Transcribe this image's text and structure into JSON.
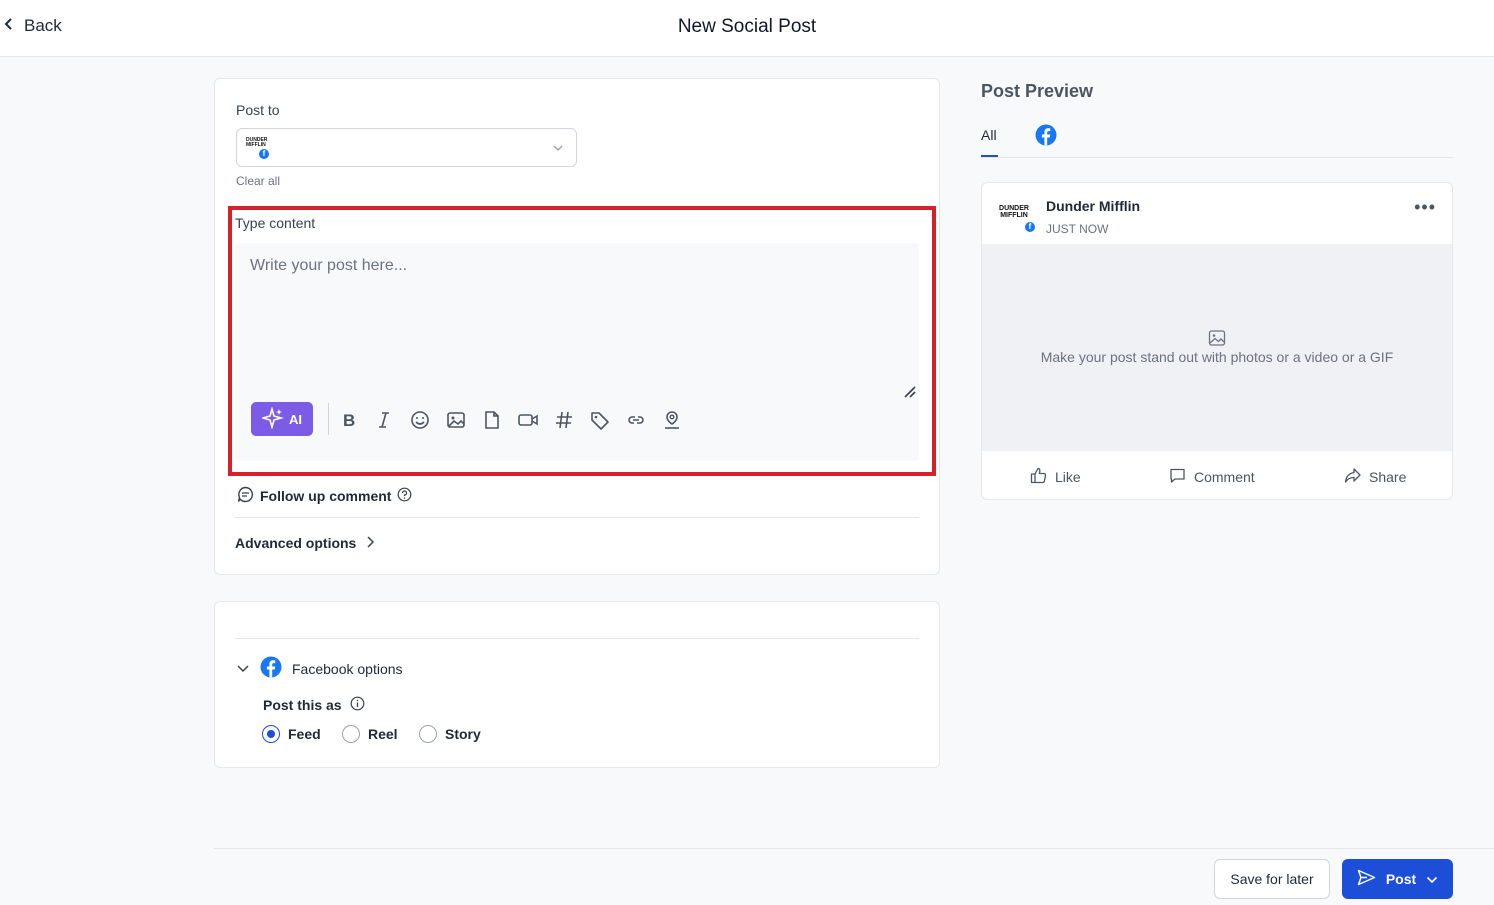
{
  "header": {
    "back_label": "Back",
    "title": "New Social Post"
  },
  "composer": {
    "post_to_label": "Post to",
    "account_avatar_text": "DUNDER MIFFLIN",
    "clear_all": "Clear all",
    "type_content_label": "Type content",
    "content_placeholder": "Write your post here...",
    "content_value": "",
    "ai_label": "AI",
    "toolbar_icons": [
      "bold-icon",
      "italic-icon",
      "emoji-icon",
      "image-icon",
      "file-icon",
      "video-icon",
      "hashtag-icon",
      "tag-icon",
      "link-icon",
      "location-icon"
    ],
    "follow_up_label": "Follow up comment",
    "advanced_label": "Advanced options"
  },
  "facebook_options": {
    "label": "Facebook options",
    "post_as_label": "Post this as",
    "options": [
      {
        "label": "Feed",
        "selected": true
      },
      {
        "label": "Reel",
        "selected": false
      },
      {
        "label": "Story",
        "selected": false
      }
    ]
  },
  "preview": {
    "title": "Post Preview",
    "tab_all": "All",
    "account_name": "Dunder Mifflin",
    "avatar_text": "DUNDER MIFFLIN",
    "timestamp": "JUST NOW",
    "media_hint": "Make your post stand out with photos or a video or a GIF",
    "actions": {
      "like": "Like",
      "comment": "Comment",
      "share": "Share"
    }
  },
  "footer": {
    "save_later": "Save for later",
    "post": "Post"
  },
  "colors": {
    "accent": "#1d4ed8",
    "ai": "#7c5ce6",
    "highlight": "#d8202a",
    "facebook": "#1877f2"
  }
}
